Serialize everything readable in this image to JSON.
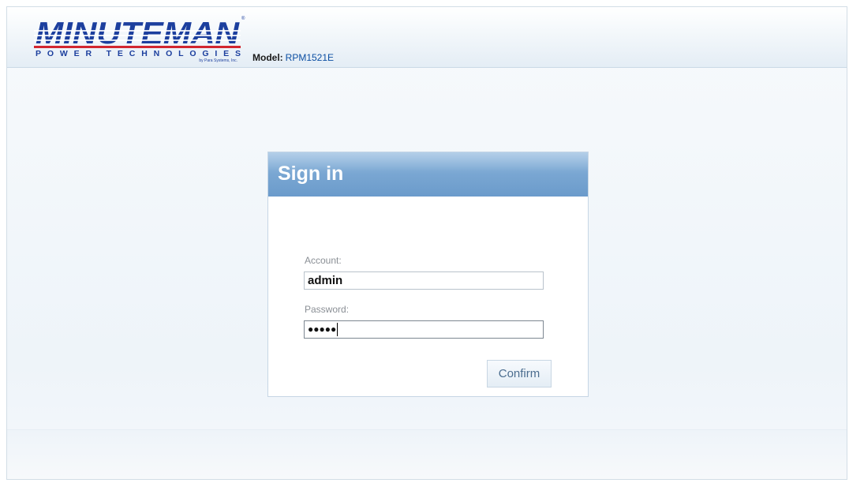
{
  "header": {
    "logo": {
      "brand": "MINUTEMAN",
      "tagline": "POWER TECHNOLOGIES",
      "subtag": "by Para Systems, Inc."
    },
    "model_label": "Model:",
    "model_value": "RPM1521E"
  },
  "signin": {
    "title": "Sign in",
    "account_label": "Account:",
    "account_value": "admin",
    "password_label": "Password:",
    "password_value": "●●●●●",
    "confirm_label": "Confirm"
  },
  "colors": {
    "brand_blue": "#1c3f9e",
    "brand_red": "#d2262f",
    "header_bar": "#79a6d2",
    "model_value": "#0b4ea2"
  }
}
